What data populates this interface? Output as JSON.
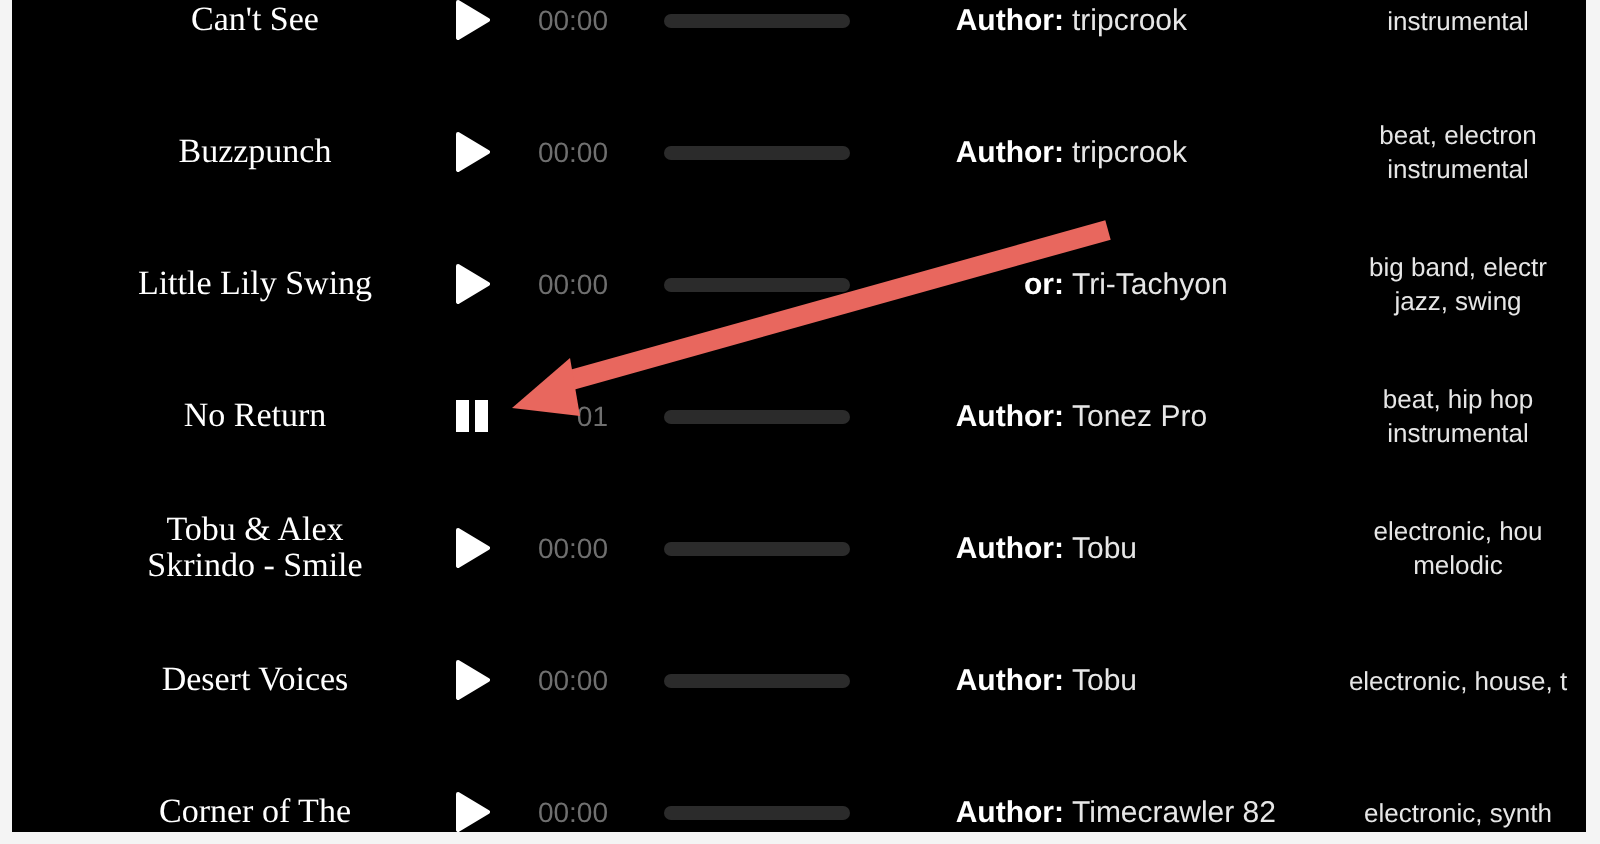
{
  "tracks": [
    {
      "title": [
        "Can't See"
      ],
      "playing": false,
      "time": "00:00",
      "author_label": "Author:",
      "author": "tripcrook",
      "tags": [
        "instrumental"
      ]
    },
    {
      "title": [
        "Buzzpunch"
      ],
      "playing": false,
      "time": "00:00",
      "author_label": "Author:",
      "author": "tripcrook",
      "tags": [
        "beat, electron",
        "instrumental"
      ]
    },
    {
      "title": [
        "Little Lily Swing"
      ],
      "playing": false,
      "time": "00:00",
      "author_label": "or:",
      "author": "Tri-Tachyon",
      "tags": [
        "big band, electr",
        "jazz, swing"
      ]
    },
    {
      "title": [
        "No Return"
      ],
      "playing": true,
      "time": "01",
      "author_label": "Author:",
      "author": "Tonez Pro",
      "tags": [
        "beat, hip hop",
        "instrumental"
      ]
    },
    {
      "title": [
        "Tobu & Alex",
        "Skrindo - Smile"
      ],
      "playing": false,
      "time": "00:00",
      "author_label": "Author:",
      "author": "Tobu",
      "tags": [
        "electronic, hou",
        "melodic"
      ]
    },
    {
      "title": [
        "Desert Voices"
      ],
      "playing": false,
      "time": "00:00",
      "author_label": "Author:",
      "author": "Tobu",
      "tags": [
        "electronic, house, t"
      ]
    },
    {
      "title": [
        "Corner of The"
      ],
      "playing": false,
      "time": "00:00",
      "author_label": "Author:",
      "author": "Timecrawler 82",
      "tags": [
        "electronic, synth"
      ]
    }
  ]
}
